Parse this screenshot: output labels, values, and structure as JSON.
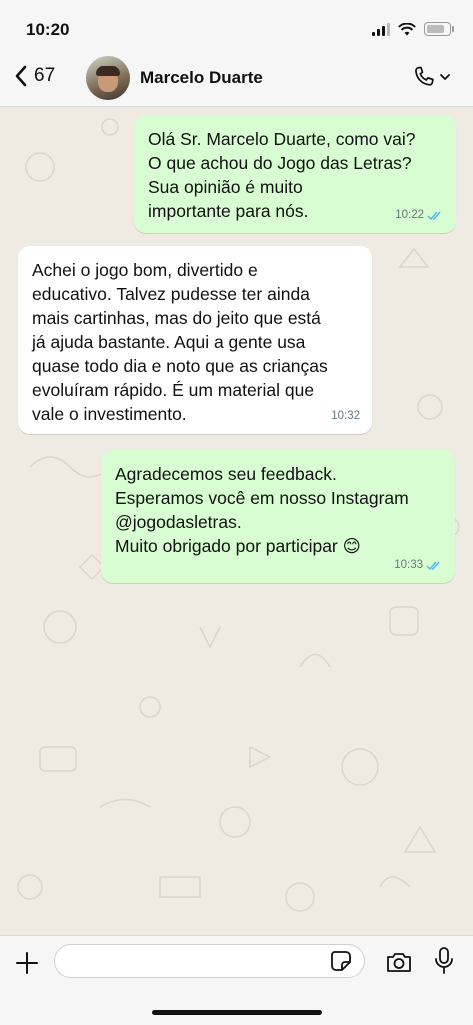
{
  "status_bar": {
    "time": "10:20"
  },
  "header": {
    "back_count": "67",
    "contact_name": "Marcelo Duarte",
    "icons": {
      "back": "chevron-left-icon",
      "call": "phone-icon",
      "call_menu": "chevron-down-icon"
    }
  },
  "messages": [
    {
      "direction": "outgoing",
      "text": "Olá Sr. Marcelo Duarte, como vai?\nO que achou do Jogo das Letras?\nSua opinião é muito\nimportante para nós.",
      "time": "10:22",
      "status": "read"
    },
    {
      "direction": "incoming",
      "text": "Achei o jogo bom, divertido e\neducativo. Talvez pudesse ter ainda\nmais cartinhas, mas do jeito que está\njá ajuda bastante. Aqui a gente usa\nquase todo dia e noto que as crianças\nevoluíram rápido. É um material que\nvale o investimento.",
      "time": "10:32"
    },
    {
      "direction": "outgoing",
      "text": "Agradecemos seu feedback.\nEsperamos você em nosso Instagram\n@jogodasletras.\nMuito obrigado por participar 😊",
      "time": "10:33",
      "status": "read"
    }
  ],
  "composer": {
    "placeholder": "",
    "icons": {
      "add": "plus-icon",
      "sticker": "sticker-icon",
      "camera": "camera-icon",
      "mic": "microphone-icon"
    }
  },
  "colors": {
    "chat_background": "#efeae2",
    "outgoing_bubble": "#d9fdd3",
    "incoming_bubble": "#ffffff",
    "read_ticks": "#53bdeb"
  }
}
